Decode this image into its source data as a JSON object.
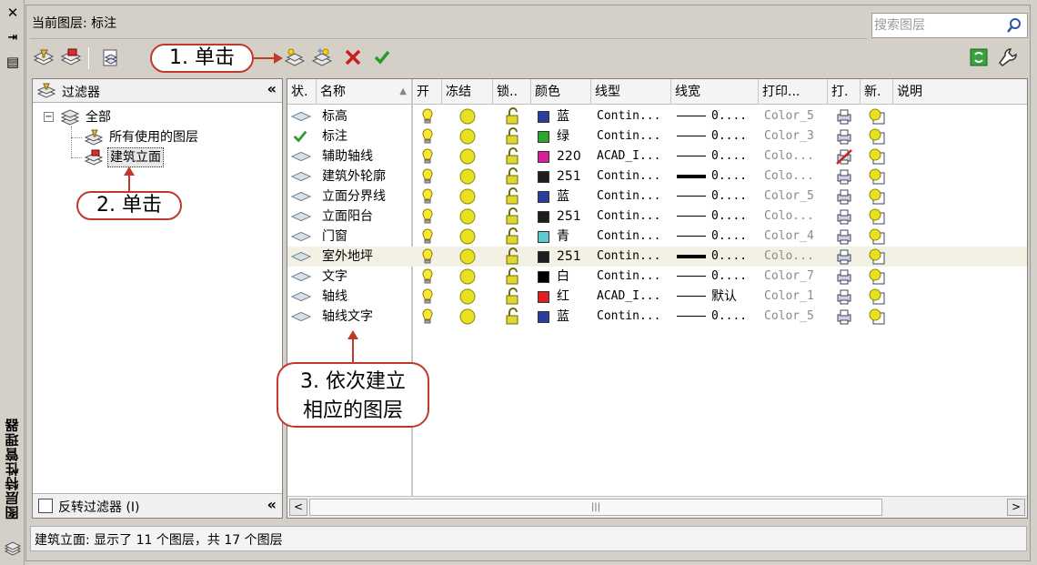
{
  "side_strip": {
    "title": "图层特性管理器",
    "close": "✕",
    "pin": "⇥",
    "props": "▤"
  },
  "header": {
    "current_layer": "当前图层: 标注",
    "search_placeholder": "搜索图层"
  },
  "callouts": {
    "step1": "1. 单击",
    "step2": "2. 单击",
    "step3_line1": "3. 依次建立",
    "step3_line2": "相应的图层"
  },
  "filter_pane": {
    "title": "过滤器",
    "collapse": "«",
    "tree": [
      {
        "label": "全部"
      },
      {
        "label": "所有使用的图层"
      },
      {
        "label": "建筑立面"
      }
    ],
    "invert_label": "反转过滤器 (I)",
    "footer_collapse": "«"
  },
  "list": {
    "columns": [
      "状.",
      "名称",
      "开",
      "冻结",
      "锁..",
      "颜色",
      "线型",
      "线宽",
      "打印...",
      "打.",
      "新.",
      "说明"
    ],
    "rows": [
      {
        "status": "layer",
        "name": "标高",
        "color_swatch": "#2a3f9a",
        "color_name": "蓝",
        "linetype": "Contin...",
        "lineweight": "0....",
        "lw_thick": false,
        "plot_style": "Color_5",
        "plot": "on"
      },
      {
        "status": "current",
        "name": "标注",
        "color_swatch": "#2ea52e",
        "color_name": "绿",
        "linetype": "Contin...",
        "lineweight": "0....",
        "lw_thick": false,
        "plot_style": "Color_3",
        "plot": "on"
      },
      {
        "status": "layer",
        "name": "辅助轴线",
        "color_swatch": "#d6219a",
        "color_name": "220",
        "linetype": "ACAD_I...",
        "lineweight": "0....",
        "lw_thick": false,
        "plot_style": "Colo...",
        "plot": "off"
      },
      {
        "status": "layer",
        "name": "建筑外轮廓",
        "color_swatch": "#1e1e1e",
        "color_name": "251",
        "linetype": "Contin...",
        "lineweight": "0....",
        "lw_thick": true,
        "plot_style": "Colo...",
        "plot": "on"
      },
      {
        "status": "layer",
        "name": "立面分界线",
        "color_swatch": "#2a3f9a",
        "color_name": "蓝",
        "linetype": "Contin...",
        "lineweight": "0....",
        "lw_thick": false,
        "plot_style": "Color_5",
        "plot": "on"
      },
      {
        "status": "layer",
        "name": "立面阳台",
        "color_swatch": "#1e1e1e",
        "color_name": "251",
        "linetype": "Contin...",
        "lineweight": "0....",
        "lw_thick": false,
        "plot_style": "Colo...",
        "plot": "on"
      },
      {
        "status": "layer",
        "name": "门窗",
        "color_swatch": "#5ec8d0",
        "color_name": "青",
        "linetype": "Contin...",
        "lineweight": "0....",
        "lw_thick": false,
        "plot_style": "Color_4",
        "plot": "on"
      },
      {
        "status": "layer",
        "name": "室外地坪",
        "color_swatch": "#1e1e1e",
        "color_name": "251",
        "linetype": "Contin...",
        "lineweight": "0....",
        "lw_thick": true,
        "plot_style": "Colo...",
        "plot": "on",
        "selected": true
      },
      {
        "status": "layer",
        "name": "文字",
        "color_swatch": "#000000",
        "color_name": "白",
        "linetype": "Contin...",
        "lineweight": "0....",
        "lw_thick": false,
        "plot_style": "Color_7",
        "plot": "on"
      },
      {
        "status": "layer",
        "name": "轴线",
        "color_swatch": "#e02020",
        "color_name": "红",
        "linetype": "ACAD_I...",
        "lineweight": "默认",
        "lw_thick": false,
        "plot_style": "Color_1",
        "plot": "on"
      },
      {
        "status": "layer",
        "name": "轴线文字",
        "color_swatch": "#2a3f9a",
        "color_name": "蓝",
        "linetype": "Contin...",
        "lineweight": "0....",
        "lw_thick": false,
        "plot_style": "Color_5",
        "plot": "on"
      }
    ]
  },
  "scrollbar": {
    "left": "<",
    "right": ">",
    "thumb": "|||"
  },
  "status": "建筑立面: 显示了 11 个图层，共 17 个图层",
  "colors": {
    "callout_border": "#c0392b",
    "selected_row": "#f3f1e3"
  }
}
